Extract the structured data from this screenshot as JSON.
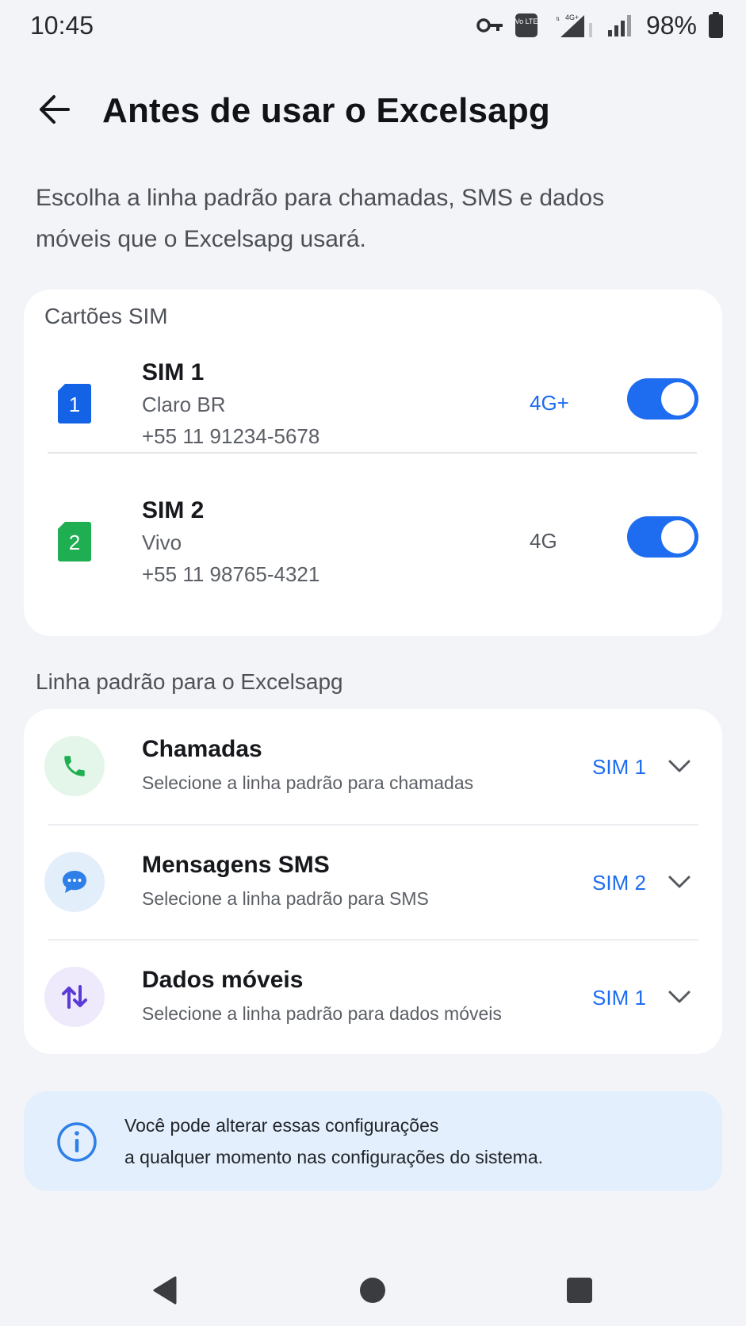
{
  "status_bar": {
    "time": "10:45",
    "volte_label": "Vo LTE",
    "network_badge": "4G+",
    "battery": "98%"
  },
  "header": {
    "title": "Antes de usar o Excelsapg"
  },
  "intro": {
    "line1": "Escolha a linha padrão para chamadas, SMS e dados",
    "line2": "móveis que o Excelsapg usará."
  },
  "sim_section": {
    "label": "Cartões SIM",
    "sims": [
      {
        "badge": "1",
        "name": "SIM 1",
        "carrier": "Claro BR",
        "number": "+55 11 91234-5678",
        "network": "4G+",
        "network_color": "#1e6cf0",
        "badge_color": "#1463e6",
        "enabled": true
      },
      {
        "badge": "2",
        "name": "SIM 2",
        "carrier": "Vivo",
        "number": "+55 11 98765-4321",
        "network": "4G",
        "network_color": "#55595f",
        "badge_color": "#1fae52",
        "enabled": true
      }
    ]
  },
  "default_section": {
    "label": "Linha padrão para o Excelsapg",
    "items": [
      {
        "icon": "phone-icon",
        "title": "Chamadas",
        "subtitle": "Selecione a linha padrão para chamadas",
        "value": "SIM 1"
      },
      {
        "icon": "message-icon",
        "title": "Mensagens SMS",
        "subtitle": "Selecione a linha padrão para SMS",
        "value": "SIM 2"
      },
      {
        "icon": "data-transfer-icon",
        "title": "Dados móveis",
        "subtitle": "Selecione a linha padrão para dados móveis",
        "value": "SIM 1"
      }
    ]
  },
  "info": {
    "line1": "Você pode alterar essas configurações",
    "line2": "a qualquer momento nas configurações do sistema."
  },
  "colors": {
    "accent": "#1e6cf0",
    "background": "#f3f4f8",
    "info_background": "#e3effc"
  }
}
